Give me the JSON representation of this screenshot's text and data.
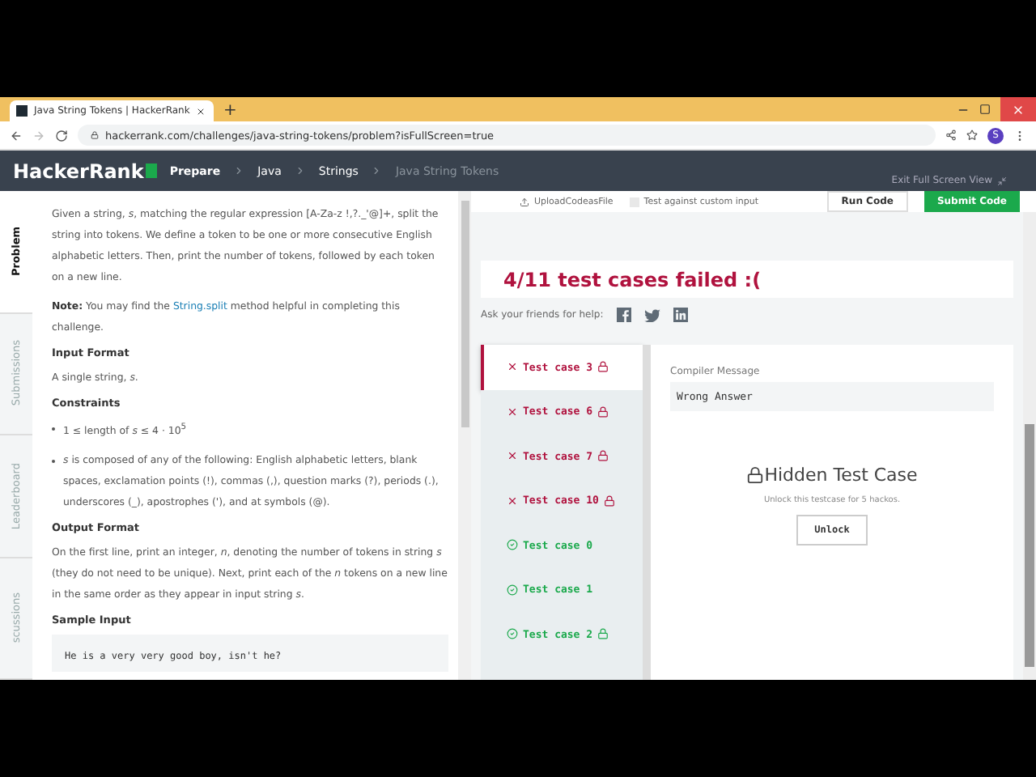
{
  "browser": {
    "tab_title": "Java String Tokens | HackerRank",
    "new_tab": "+",
    "url": "hackerrank.com/challenges/java-string-tokens/problem?isFullScreen=true",
    "profile": "S"
  },
  "nav": {
    "logo": "HackerRank",
    "breadcrumbs": [
      "Prepare",
      "Java",
      "Strings",
      "Java String Tokens"
    ]
  },
  "side_tabs": [
    {
      "label": "Problem",
      "selected": true
    },
    {
      "label": "Submissions",
      "selected": false
    },
    {
      "label": "Leaderboard",
      "selected": false
    },
    {
      "label": "scussions",
      "selected": false
    }
  ],
  "problem": [
    {
      "kind": "para",
      "text": "Given a string, *s*, matching the regular expression [A-Za-z !,?._'@]+, split the string into tokens. We define a token to be one or more consecutive English alphabetic letters. Then, print the number of tokens, followed by each token on a new line."
    },
    {
      "kind": "note",
      "label": "Note:",
      "before": "You may find the",
      "link": "String.split",
      "after": "method helpful in completing this challenge."
    },
    {
      "kind": "heading",
      "text": "Input Format"
    },
    {
      "kind": "para",
      "text": "A single string, *s*."
    },
    {
      "kind": "heading",
      "text": "Constraints"
    },
    {
      "kind": "bullet",
      "text": "1 ≤ length of *s* ≤ 4 · 10$^{5}$"
    },
    {
      "kind": "bullet",
      "text": "*s* is composed of any of the following: English alphabetic letters, blank spaces, exclamation points (!), commas (,), question marks (?), periods (.), underscores (_), apostrophes ('), and at symbols (@)."
    },
    {
      "kind": "heading",
      "text": "Output Format"
    },
    {
      "kind": "para",
      "text": "On the first line, print an integer, *n*, denoting the number of tokens in string *s* (they do not need to be unique). Next, print each of the *n* tokens on a new line in the same order as they appear in input string *s*."
    },
    {
      "kind": "heading",
      "text": "Sample Input"
    },
    {
      "kind": "code",
      "text": "He is a very very good boy, isn't he?"
    }
  ],
  "toolbar": {
    "upload": "UploadCodeasFile",
    "custom_input": {
      "label": "Test against custom input",
      "checked": false
    },
    "run": "Run Code",
    "submit": "Submit Code",
    "exit": "Exit Full Screen View"
  },
  "result": {
    "title": "4/11 test cases failed :(",
    "ask": "Ask your friends for help:"
  },
  "test_cases": [
    {
      "label": "Test case 3",
      "passed": false,
      "locked": true,
      "selected": true
    },
    {
      "label": "Test case 6",
      "passed": false,
      "locked": true,
      "selected": false
    },
    {
      "label": "Test case 7",
      "passed": false,
      "locked": true,
      "selected": false
    },
    {
      "label": "Test case 10",
      "passed": false,
      "locked": true,
      "selected": false
    },
    {
      "label": "Test case 0",
      "passed": true,
      "locked": false,
      "selected": false
    },
    {
      "label": "Test case 1",
      "passed": true,
      "locked": false,
      "selected": false
    },
    {
      "label": "Test case 2",
      "passed": true,
      "locked": true,
      "selected": false
    }
  ],
  "detail": {
    "compiler_label": "Compiler Message",
    "message": "Wrong Answer",
    "hidden_title": "Hidden Test Case",
    "hidden_note": "Unlock this testcase for 5 hackos.",
    "unlock": "Unlock"
  }
}
